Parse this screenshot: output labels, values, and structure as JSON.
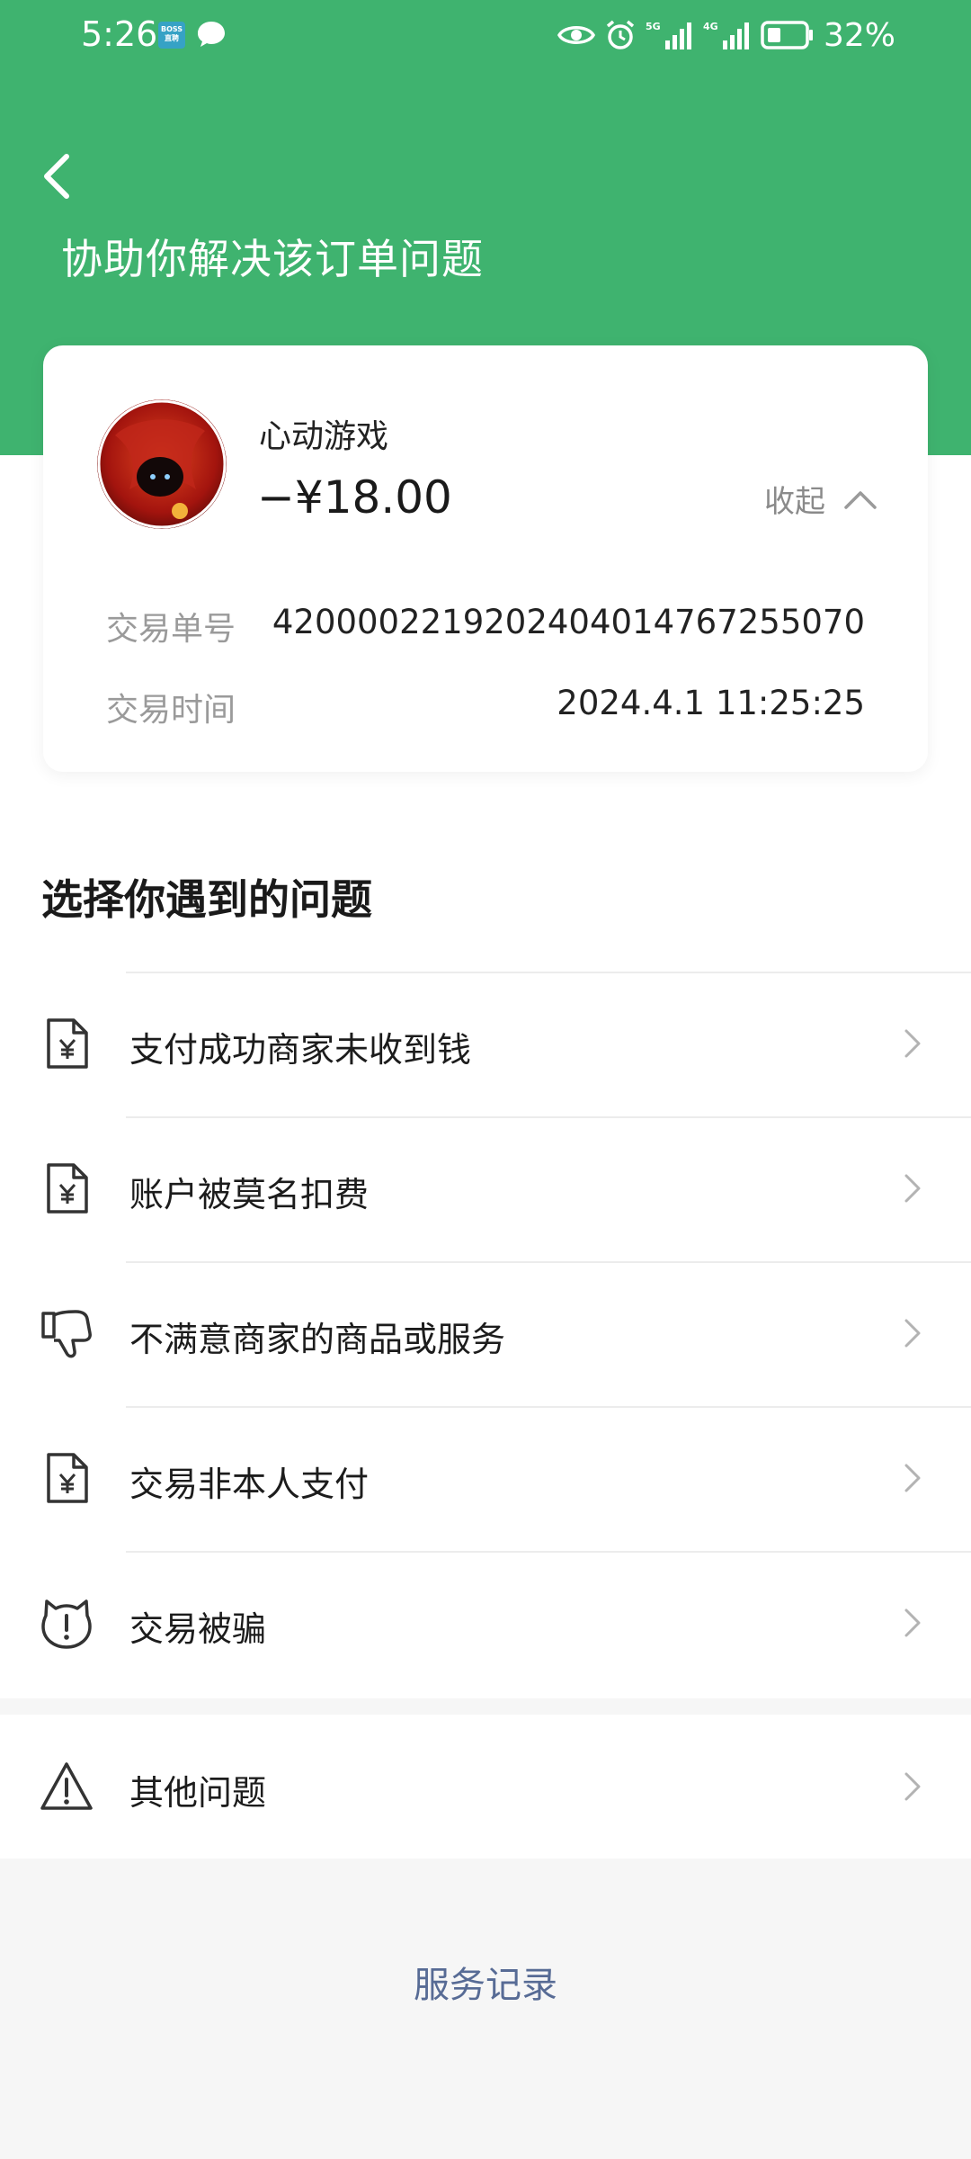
{
  "status_bar": {
    "time": "5:26",
    "badge_text": "BOSS 直聘",
    "battery": "32%",
    "net1": "5G",
    "net2": "4G"
  },
  "header": {
    "title": "协助你解决该订单问题"
  },
  "order": {
    "merchant": "心动游戏",
    "amount": "−¥18.00",
    "collapse_label": "收起",
    "transaction_no_label": "交易单号",
    "transaction_no": "4200002219202404014767255070",
    "transaction_time_label": "交易时间",
    "transaction_time": "2024.4.1 11:25:25"
  },
  "issues": {
    "title": "选择你遇到的问题",
    "items": [
      {
        "label": "支付成功商家未收到钱",
        "icon": "receipt-yuan-icon"
      },
      {
        "label": "账户被莫名扣费",
        "icon": "receipt-yuan-icon"
      },
      {
        "label": "不满意商家的商品或服务",
        "icon": "thumbs-down-icon"
      },
      {
        "label": "交易非本人支付",
        "icon": "receipt-yuan-icon"
      },
      {
        "label": "交易被骗",
        "icon": "alert-shield-icon"
      }
    ],
    "other": {
      "label": "其他问题",
      "icon": "warning-triangle-icon"
    }
  },
  "footer": {
    "service_record": "服务记录"
  },
  "colors": {
    "brand_green": "#3fb36f",
    "link_blue": "#576b95"
  }
}
